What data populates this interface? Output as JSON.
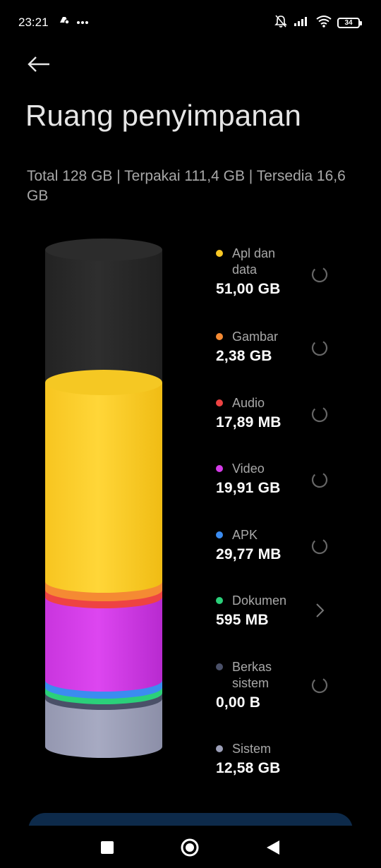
{
  "status_bar": {
    "time": "23:21",
    "battery": "34",
    "icons": [
      "drive-icon",
      "more-dots-icon",
      "mute-bell-icon",
      "signal-icon",
      "wifi-icon"
    ]
  },
  "header": {
    "title": "Ruang penyimpanan"
  },
  "summary": {
    "text": "Total 128 GB | Terpakai 111,4 GB | Tersedia 16,6 GB"
  },
  "categories": [
    {
      "label": "Apl dan data",
      "value": "51,00 GB",
      "color": "#f9c825",
      "action": "spinner"
    },
    {
      "label": "Gambar",
      "value": "2,38 GB",
      "color": "#f58a33",
      "action": "spinner"
    },
    {
      "label": "Audio",
      "value": "17,89 MB",
      "color": "#ee4343",
      "action": "spinner"
    },
    {
      "label": "Video",
      "value": "19,91 GB",
      "color": "#d53ce8",
      "action": "spinner"
    },
    {
      "label": "APK",
      "value": "29,77 MB",
      "color": "#3b8cf0",
      "action": "spinner"
    },
    {
      "label": "Dokumen",
      "value": "595 MB",
      "color": "#2bd07a",
      "action": "chevron"
    },
    {
      "label": "Berkas sistem",
      "value": "0,00 B",
      "color": "#4a5068",
      "action": "spinner"
    },
    {
      "label": "Sistem",
      "value": "12,58 GB",
      "color": "#9c9fb8",
      "action": "none"
    }
  ],
  "colors": {
    "free": "#2a2a2a",
    "accent_bar": "#0d2a4a"
  },
  "nav": [
    "recents-button",
    "home-button",
    "back-button"
  ]
}
